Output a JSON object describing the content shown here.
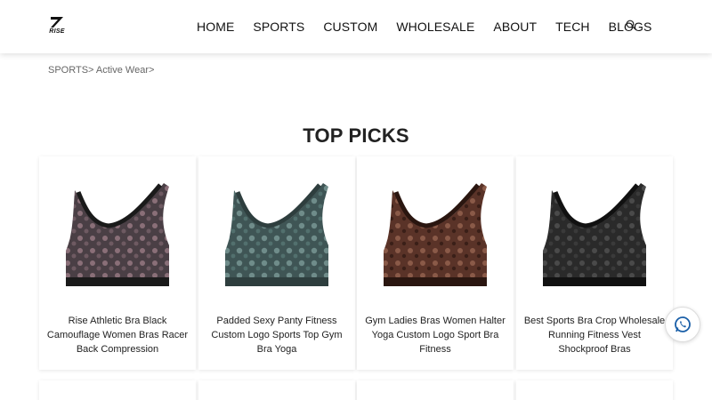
{
  "brand": {
    "logo_text": "RISE"
  },
  "nav": {
    "items": [
      "HOME",
      "SPORTS",
      "CUSTOM",
      "WHOLESALE",
      "ABOUT",
      "TECH",
      "BLOGS"
    ],
    "search_icon": "search-icon"
  },
  "breadcrumb": {
    "level1": "SPORTS",
    "sep1": ">",
    "level2": " Active Wear",
    "sep2": ">"
  },
  "section": {
    "title": "TOP PICKS"
  },
  "products": [
    {
      "title": "Rise Athletic Bra Black Camouflage Women Bras Racer Back Compression",
      "color": "#4a3f45",
      "pattern": "#8a6f78"
    },
    {
      "title": "Padded Sexy Panty Fitness Custom Logo Sports Top Gym Bra Yoga",
      "color": "#3f5555",
      "pattern": "#6f8c8a"
    },
    {
      "title": "Gym Ladies Bras Women Halter Yoga Custom Logo Sport Bra Fitness",
      "color": "#5a3328",
      "pattern": "#8a5a48"
    },
    {
      "title": "Best Sports Bra Crop Wholesale Running Fitness Vest Shockproof Bras",
      "color": "#2a2a2a",
      "pattern": "#4a4a4a"
    }
  ],
  "whatsapp": {
    "icon": "whatsapp-icon",
    "color": "#1a5fa8"
  }
}
